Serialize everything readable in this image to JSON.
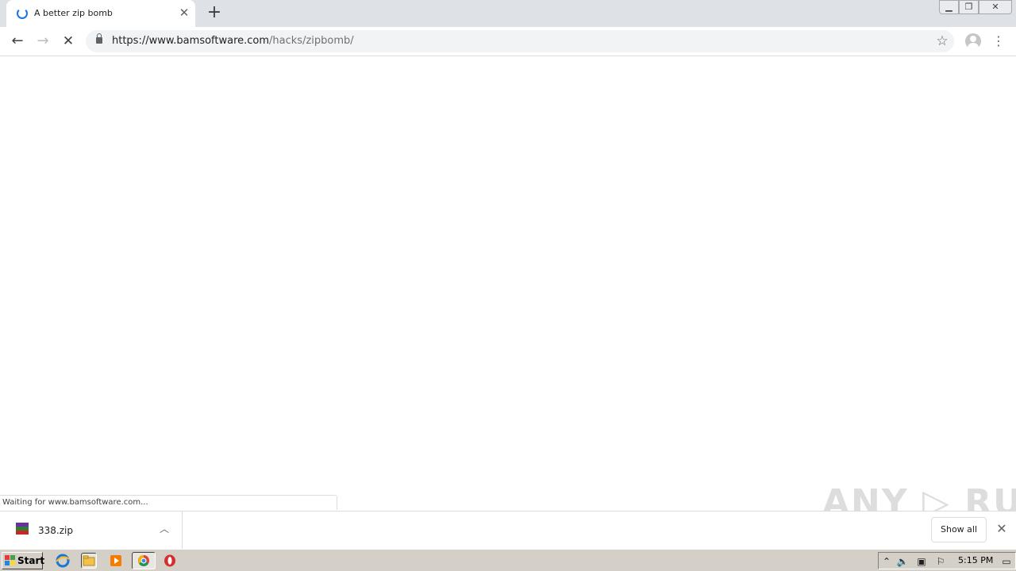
{
  "browser": {
    "tab_title": "A better zip bomb",
    "url_host": "https://www.bamsoftware.com",
    "url_path": "/hacks/zipbomb/",
    "status_text": "Waiting for www.bamsoftware.com..."
  },
  "downloads": {
    "file_name": "338.zip",
    "show_all_label": "Show all"
  },
  "watermark": "ANY ▷ RUN",
  "taskbar": {
    "start_label": "Start",
    "clock": "5:15 PM"
  },
  "icons": [
    "loading-spinner-icon",
    "close-icon",
    "plus-icon",
    "back-arrow-icon",
    "forward-arrow-icon",
    "stop-icon",
    "lock-icon",
    "star-icon",
    "avatar-icon",
    "menu-icon",
    "winrar-icon",
    "chevron-up-icon",
    "windows-logo-icon",
    "ie-icon",
    "folder-icon",
    "media-player-icon",
    "chrome-icon",
    "opera-icon",
    "volume-icon",
    "network-icon",
    "flag-icon"
  ],
  "colors": {
    "accent": "#1a73e8",
    "tabstrip": "#dee1e6",
    "taskbar": "#d4d0c8"
  }
}
